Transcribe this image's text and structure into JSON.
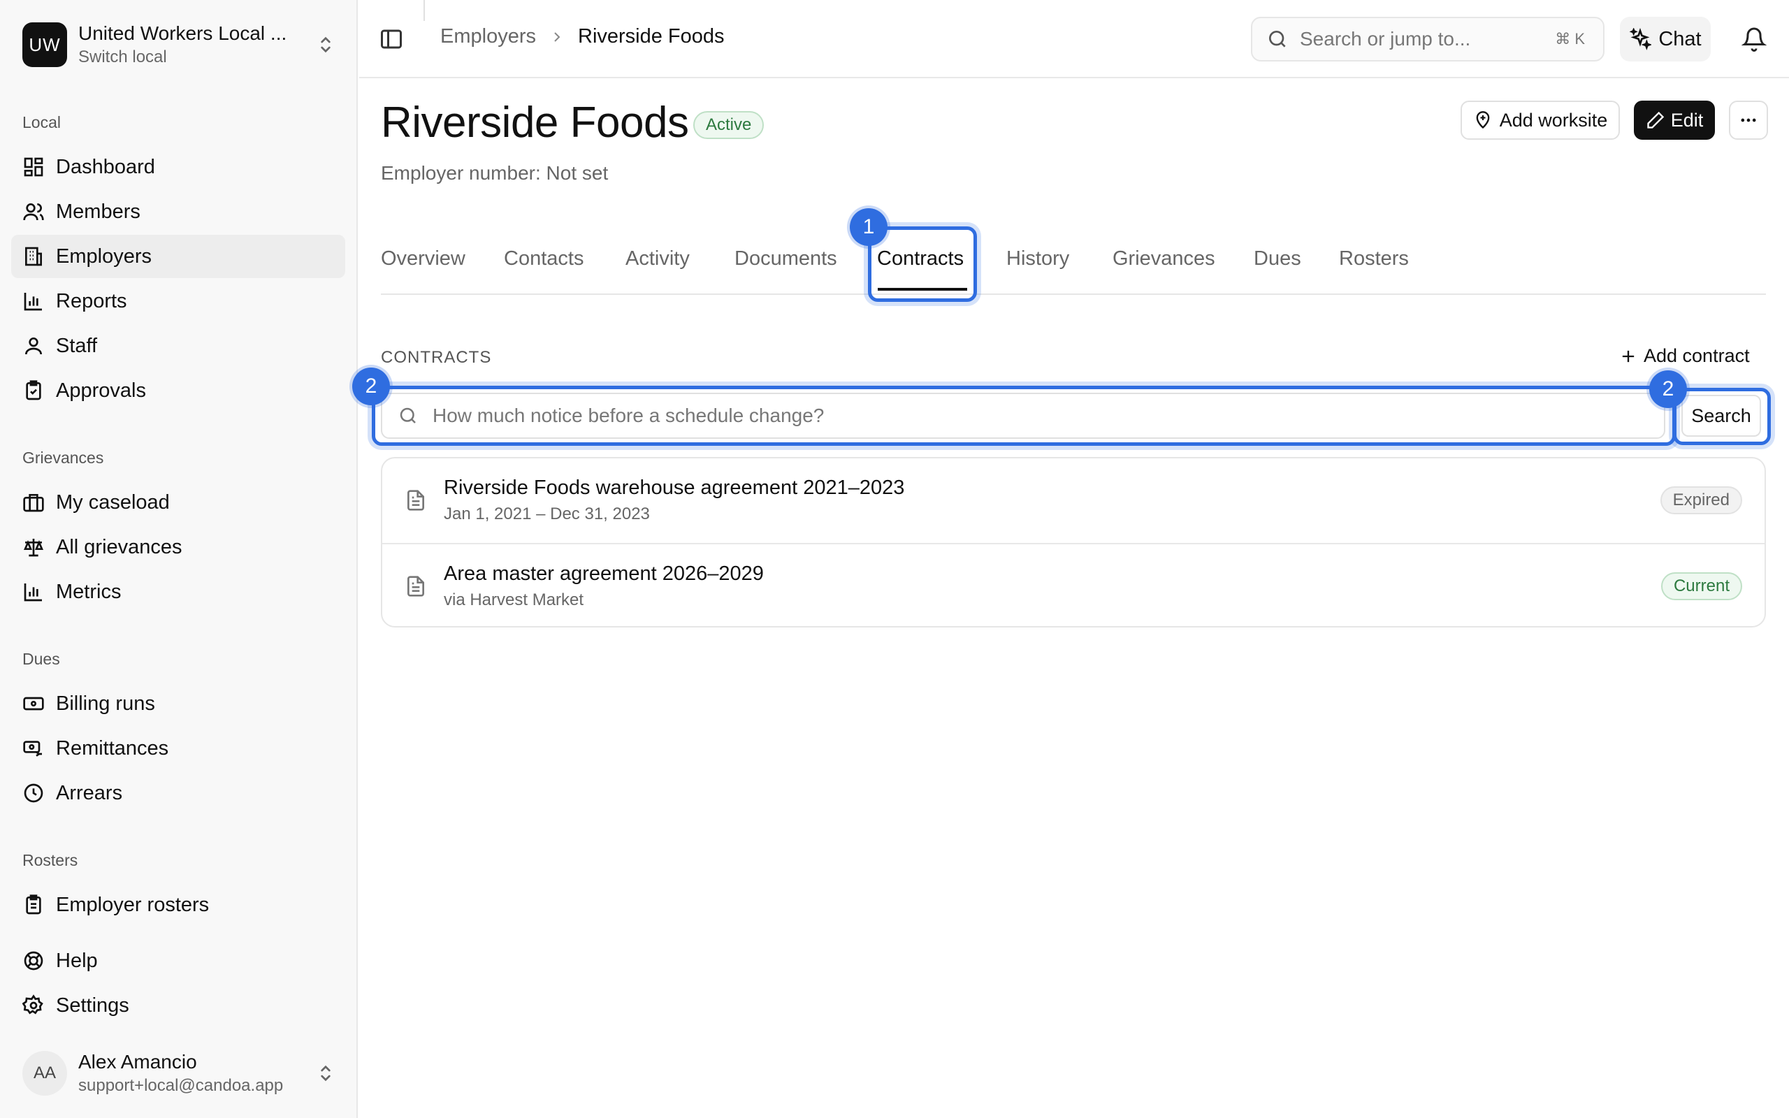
{
  "org": {
    "initials": "UW",
    "name": "United Workers Local ...",
    "sub": "Switch local"
  },
  "nav": {
    "local_label": "Local",
    "local": [
      "Dashboard",
      "Members",
      "Employers",
      "Reports",
      "Staff",
      "Approvals"
    ],
    "grievances_label": "Grievances",
    "grievances": [
      "My caseload",
      "All grievances",
      "Metrics"
    ],
    "dues_label": "Dues",
    "dues": [
      "Billing runs",
      "Remittances",
      "Arrears"
    ],
    "rosters_label": "Rosters",
    "rosters": [
      "Employer rosters"
    ],
    "bottom": [
      "Help",
      "Settings"
    ],
    "active": "Employers"
  },
  "user": {
    "initials": "AA",
    "name": "Alex Amancio",
    "email": "support+local@candoa.app"
  },
  "topbar": {
    "breadcrumb": [
      "Employers",
      "Riverside Foods"
    ],
    "search_placeholder": "Search or jump to...",
    "shortcut": "⌘   K",
    "chat_label": "Chat"
  },
  "page": {
    "title": "Riverside Foods",
    "status": "Active",
    "employer_number": "Employer number: Not set",
    "add_worksite": "Add worksite",
    "edit": "Edit"
  },
  "tabs": [
    "Overview",
    "Contacts",
    "Activity",
    "Documents",
    "Contracts",
    "History",
    "Grievances",
    "Dues",
    "Rosters"
  ],
  "active_tab": "Contracts",
  "contracts": {
    "section_title": "CONTRACTS",
    "add_label": "Add contract",
    "search_placeholder": "How much notice before a schedule change?",
    "search_button": "Search",
    "items": [
      {
        "title": "Riverside Foods warehouse agreement 2021–2023",
        "sub": "Jan 1, 2021 – Dec 31, 2023",
        "status": "Expired"
      },
      {
        "title": "Area master agreement 2026–2029",
        "sub": "via Harvest Market",
        "status": "Current"
      }
    ]
  },
  "markers": [
    "1",
    "2",
    "2"
  ],
  "colors": {
    "highlight": "#2f6de0",
    "success": "#2d7a3f"
  }
}
